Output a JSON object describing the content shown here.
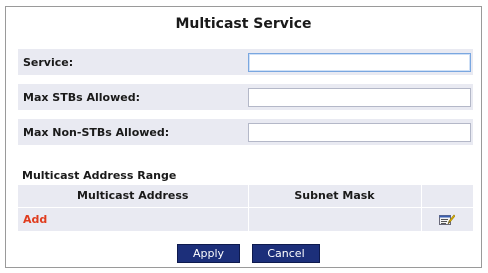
{
  "title": "Multicast Service",
  "form": {
    "service_label": "Service:",
    "service_value": "",
    "max_stbs_label": "Max STBs Allowed:",
    "max_stbs_value": "",
    "max_non_stbs_label": "Max Non-STBs Allowed:",
    "max_non_stbs_value": ""
  },
  "range": {
    "title": "Multicast Address Range",
    "columns": [
      "Multicast Address",
      "Subnet Mask",
      ""
    ],
    "add_label": "Add",
    "edit_icon": "edit-note-icon"
  },
  "buttons": {
    "apply": "Apply",
    "cancel": "Cancel"
  },
  "colors": {
    "accent_button": "#1c2f7a",
    "add_link": "#e03c1e",
    "row_background": "#e9eaf2"
  }
}
